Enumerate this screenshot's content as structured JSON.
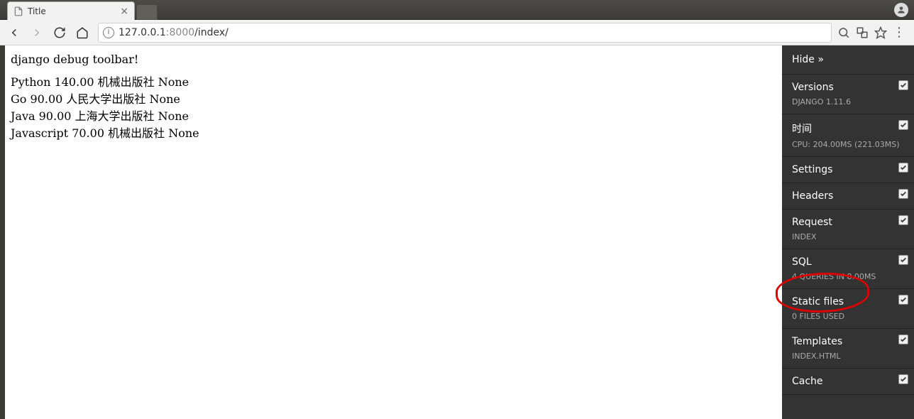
{
  "window": {
    "tab_title": "Title",
    "url_host": "127.0.0.1",
    "url_port": ":8000",
    "url_path": "/index/"
  },
  "page": {
    "heading": "django debug toolbar!",
    "rows": [
      "Python 140.00 机械出版社 None",
      "Go 90.00 人民大学出版社 None",
      "Java 90.00 上海大学出版社 None",
      "Javascript 70.00 机械出版社 None"
    ]
  },
  "toolbar": {
    "hide_label": "Hide »",
    "items": [
      {
        "title": "Versions",
        "sub": "DJANGO 1.11.6",
        "checked": true
      },
      {
        "title": "时间",
        "sub": "CPU: 204.00MS (221.03MS)",
        "checked": true
      },
      {
        "title": "Settings",
        "sub": "",
        "checked": true
      },
      {
        "title": "Headers",
        "sub": "",
        "checked": true
      },
      {
        "title": "Request",
        "sub": "INDEX",
        "checked": true
      },
      {
        "title": "SQL",
        "sub": "4 QUERIES IN 8.00MS",
        "checked": true
      },
      {
        "title": "Static files",
        "sub": "0 FILES USED",
        "checked": true
      },
      {
        "title": "Templates",
        "sub": "INDEX.HTML",
        "checked": true
      },
      {
        "title": "Cache",
        "sub": "",
        "checked": true
      }
    ]
  }
}
